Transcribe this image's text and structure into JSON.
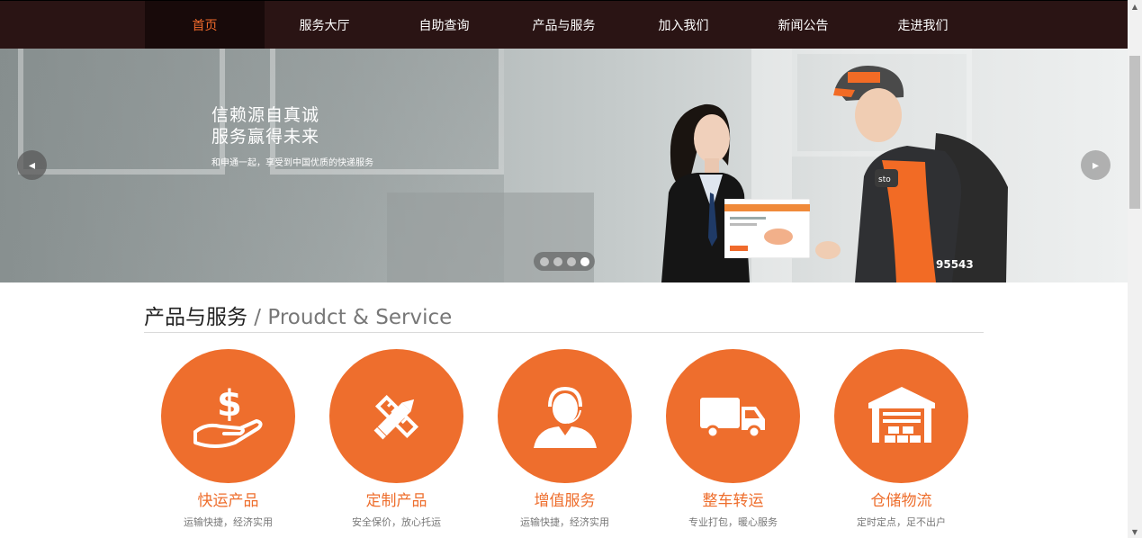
{
  "nav": {
    "items": [
      {
        "label": "首页",
        "active": true
      },
      {
        "label": "服务大厅"
      },
      {
        "label": "自助查询"
      },
      {
        "label": "产品与服务"
      },
      {
        "label": "加入我们"
      },
      {
        "label": "新闻公告"
      },
      {
        "label": "走进我们"
      }
    ]
  },
  "banner": {
    "title_line1": "信赖源自真诚",
    "title_line2": "服务赢得未来",
    "subtitle": "和申通一起，享受到中国优质的快递服务",
    "prev_icon": "chevron-left-icon",
    "next_icon": "chevron-right-icon",
    "slide_count": 4,
    "active_slide": 4,
    "photo_text": {
      "badge": "sto",
      "phone": "95543"
    }
  },
  "section": {
    "title_cn": "产品与服务",
    "title_en": " / Proudct & Service"
  },
  "products": [
    {
      "name": "快运产品",
      "desc": "运输快捷，经济实用",
      "icon": "money-hand-icon"
    },
    {
      "name": "定制产品",
      "desc": "安全保价，放心托运",
      "icon": "pencil-ruler-icon"
    },
    {
      "name": "增值服务",
      "desc": "运输快捷，经济实用",
      "icon": "support-agent-icon"
    },
    {
      "name": "整车转运",
      "desc": "专业打包，暖心服务",
      "icon": "truck-icon"
    },
    {
      "name": "仓储物流",
      "desc": "定时定点，足不出户",
      "icon": "warehouse-icon"
    }
  ],
  "colors": {
    "accent": "#ee6e2d",
    "nav_bg": "#2a1414",
    "nav_active_bg": "#180a0a"
  }
}
